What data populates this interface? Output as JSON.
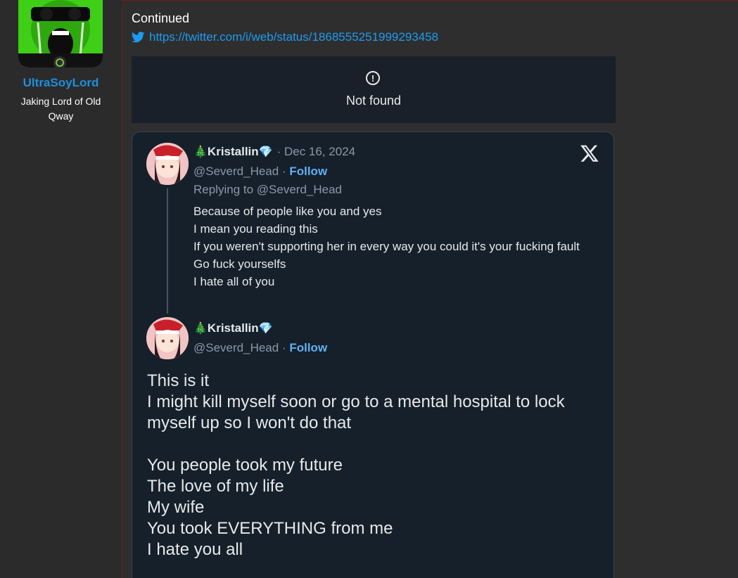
{
  "user": {
    "name": "UltraSoyLord",
    "title": "Jaking Lord of Old Qway"
  },
  "post": {
    "intro": "Continued",
    "link": "https://twitter.com/i/web/status/1868555251999293458",
    "not_found": "Not found"
  },
  "tweets": [
    {
      "emoji_before": "🎄",
      "name": "Kristallin",
      "emoji_after": "💎",
      "date": "· Dec 16, 2024",
      "handle": "@Severd_Head ·",
      "follow": "Follow",
      "reply_to": "Replying to @Severd_Head",
      "lines": [
        "Because of people like you and yes",
        "I mean you reading this",
        "If you weren't supporting her in every way you could it's your fucking fault",
        "Go fuck yourselfs",
        "I hate all of you"
      ]
    },
    {
      "emoji_before": "🎄",
      "name": "Kristallin",
      "emoji_after": "💎",
      "handle": "@Severd_Head ·",
      "follow": "Follow",
      "lines": [
        "This is it",
        "I might kill myself soon or go to a mental hospital to lock myself up so I won't do that",
        "",
        "You people took my future",
        "The love of my life",
        "My wife",
        "You took EVERYTHING from me",
        "I hate you all"
      ]
    }
  ],
  "colors": {
    "link": "#1d9bf0",
    "username": "#1f8fe0",
    "follow": "#5fb0f0",
    "embed_bg": "#15202b"
  },
  "icons": [
    "twitter-bird-icon",
    "alert-circle-icon",
    "x-logo-icon",
    "online-status-icon"
  ]
}
